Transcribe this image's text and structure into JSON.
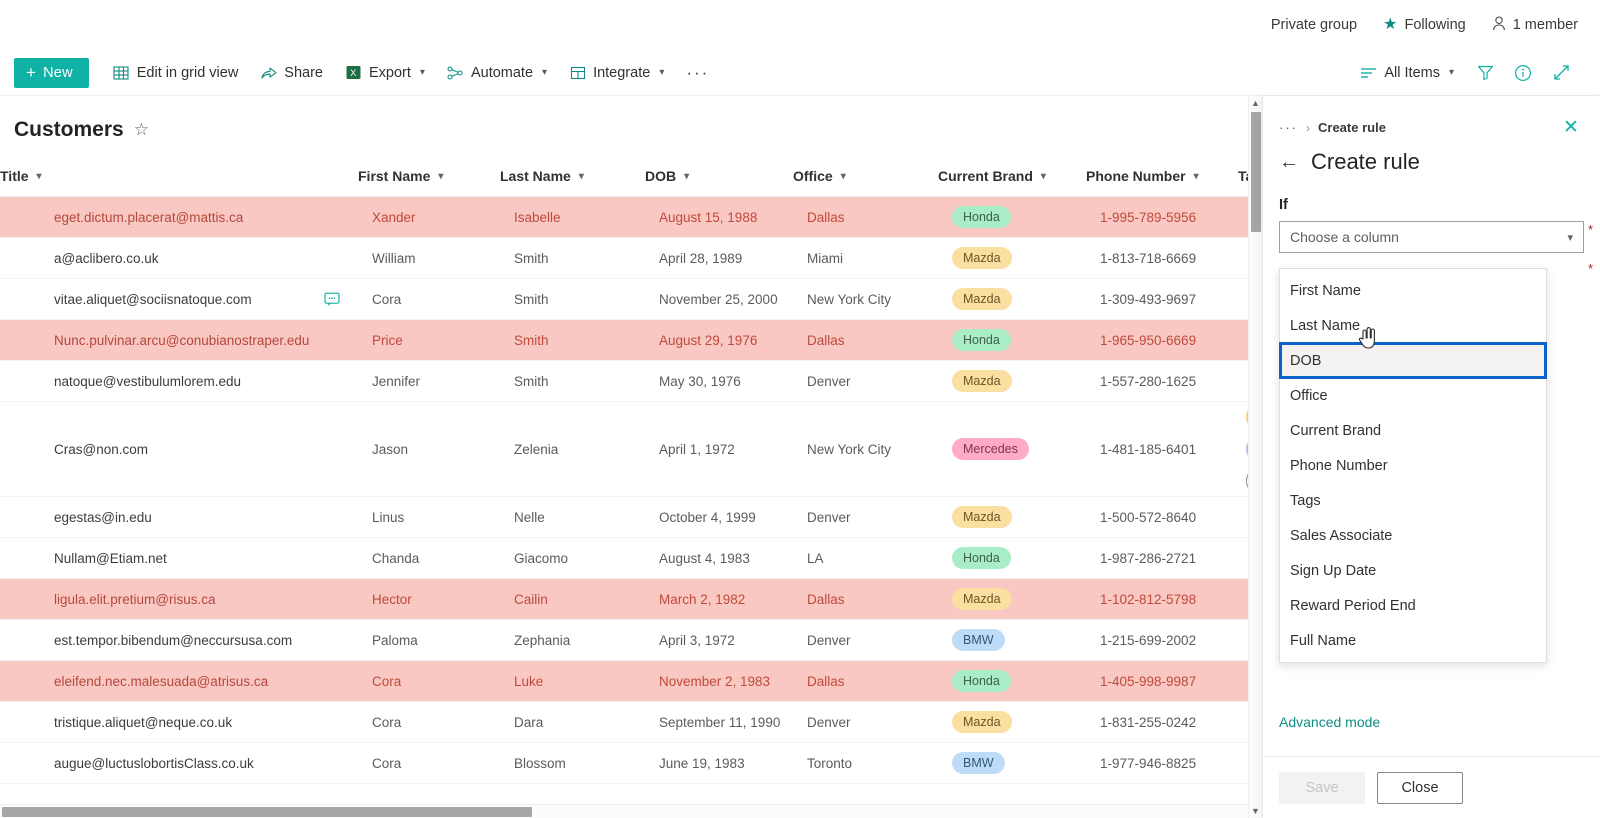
{
  "site_header": {
    "privacy": "Private group",
    "following": "Following",
    "members": "1 member"
  },
  "command_bar": {
    "new_label": "New",
    "items": [
      {
        "label": "Edit in grid view",
        "icon": "grid-icon",
        "has_chevron": false
      },
      {
        "label": "Share",
        "icon": "share-icon",
        "has_chevron": false
      },
      {
        "label": "Export",
        "icon": "excel-icon",
        "has_chevron": true
      },
      {
        "label": "Automate",
        "icon": "automate-icon",
        "has_chevron": true
      },
      {
        "label": "Integrate",
        "icon": "integrate-icon",
        "has_chevron": true
      }
    ],
    "overflow": "···",
    "view_label": "All Items",
    "right_icons": [
      "filter-icon",
      "info-icon",
      "expand-icon"
    ]
  },
  "list": {
    "title": "Customers",
    "columns": [
      "Title",
      "First Name",
      "Last Name",
      "DOB",
      "Office",
      "Current Brand",
      "Phone Number",
      "Ta"
    ],
    "rows": [
      {
        "title": "eget.dictum.placerat@mattis.ca",
        "first": "Xander",
        "last": "Isabelle",
        "dob": "August 15, 1988",
        "office": "Dallas",
        "brand": "Honda",
        "phone": "1-995-789-5956",
        "flagged": true,
        "comment": false,
        "tall": false,
        "tags": []
      },
      {
        "title": "a@aclibero.co.uk",
        "first": "William",
        "last": "Smith",
        "dob": "April 28, 1989",
        "office": "Miami",
        "brand": "Mazda",
        "phone": "1-813-718-6669",
        "flagged": false,
        "comment": false,
        "tall": false,
        "tags": []
      },
      {
        "title": "vitae.aliquet@sociisnatoque.com",
        "first": "Cora",
        "last": "Smith",
        "dob": "November 25, 2000",
        "office": "New York City",
        "brand": "Mazda",
        "phone": "1-309-493-9697",
        "flagged": false,
        "comment": true,
        "tall": false,
        "tags": []
      },
      {
        "title": "Nunc.pulvinar.arcu@conubianostraper.edu",
        "first": "Price",
        "last": "Smith",
        "dob": "August 29, 1976",
        "office": "Dallas",
        "brand": "Honda",
        "phone": "1-965-950-6669",
        "flagged": true,
        "comment": false,
        "tall": false,
        "tags": []
      },
      {
        "title": "natoque@vestibulumlorem.edu",
        "first": "Jennifer",
        "last": "Smith",
        "dob": "May 30, 1976",
        "office": "Denver",
        "brand": "Mazda",
        "phone": "1-557-280-1625",
        "flagged": false,
        "comment": false,
        "tall": false,
        "tags": []
      },
      {
        "title": "Cras@non.com",
        "first": "Jason",
        "last": "Zelenia",
        "dob": "April 1, 1972",
        "office": "New York City",
        "brand": "Mercedes",
        "phone": "1-481-185-6401",
        "flagged": false,
        "comment": false,
        "tall": true,
        "tags": [
          "#f7cd7e",
          "#c3b7e8",
          "#ffffff"
        ]
      },
      {
        "title": "egestas@in.edu",
        "first": "Linus",
        "last": "Nelle",
        "dob": "October 4, 1999",
        "office": "Denver",
        "brand": "Mazda",
        "phone": "1-500-572-8640",
        "flagged": false,
        "comment": false,
        "tall": false,
        "tags": []
      },
      {
        "title": "Nullam@Etiam.net",
        "first": "Chanda",
        "last": "Giacomo",
        "dob": "August 4, 1983",
        "office": "LA",
        "brand": "Honda",
        "phone": "1-987-286-2721",
        "flagged": false,
        "comment": false,
        "tall": false,
        "tags": []
      },
      {
        "title": "ligula.elit.pretium@risus.ca",
        "first": "Hector",
        "last": "Cailin",
        "dob": "March 2, 1982",
        "office": "Dallas",
        "brand": "Mazda",
        "phone": "1-102-812-5798",
        "flagged": true,
        "comment": false,
        "tall": false,
        "tags": []
      },
      {
        "title": "est.tempor.bibendum@neccursusa.com",
        "first": "Paloma",
        "last": "Zephania",
        "dob": "April 3, 1972",
        "office": "Denver",
        "brand": "BMW",
        "phone": "1-215-699-2002",
        "flagged": false,
        "comment": false,
        "tall": false,
        "tags": []
      },
      {
        "title": "eleifend.nec.malesuada@atrisus.ca",
        "first": "Cora",
        "last": "Luke",
        "dob": "November 2, 1983",
        "office": "Dallas",
        "brand": "Honda",
        "phone": "1-405-998-9987",
        "flagged": true,
        "comment": false,
        "tall": false,
        "tags": []
      },
      {
        "title": "tristique.aliquet@neque.co.uk",
        "first": "Cora",
        "last": "Dara",
        "dob": "September 11, 1990",
        "office": "Denver",
        "brand": "Mazda",
        "phone": "1-831-255-0242",
        "flagged": false,
        "comment": false,
        "tall": false,
        "tags": []
      },
      {
        "title": "augue@luctuslobortisClass.co.uk",
        "first": "Cora",
        "last": "Blossom",
        "dob": "June 19, 1983",
        "office": "Toronto",
        "brand": "BMW",
        "phone": "1-977-946-8825",
        "flagged": false,
        "comment": false,
        "tall": false,
        "tags": []
      }
    ]
  },
  "panel": {
    "breadcrumb_dots": "···",
    "breadcrumb_sep": "›",
    "breadcrumb_current": "Create rule",
    "heading": "Create rule",
    "if_label": "If",
    "column_placeholder": "Choose a column",
    "dropdown_options": [
      "First Name",
      "Last Name",
      "DOB",
      "Office",
      "Current Brand",
      "Phone Number",
      "Tags",
      "Sales Associate",
      "Sign Up Date",
      "Reward Period End",
      "Full Name"
    ],
    "focused_option": "DOB",
    "advanced_mode": "Advanced mode",
    "save_label": "Save",
    "close_label": "Close"
  },
  "colors": {
    "accent_teal": "#0fb2a5",
    "flag_row": "#fac8c3",
    "focus_blue": "#0d62c9"
  }
}
